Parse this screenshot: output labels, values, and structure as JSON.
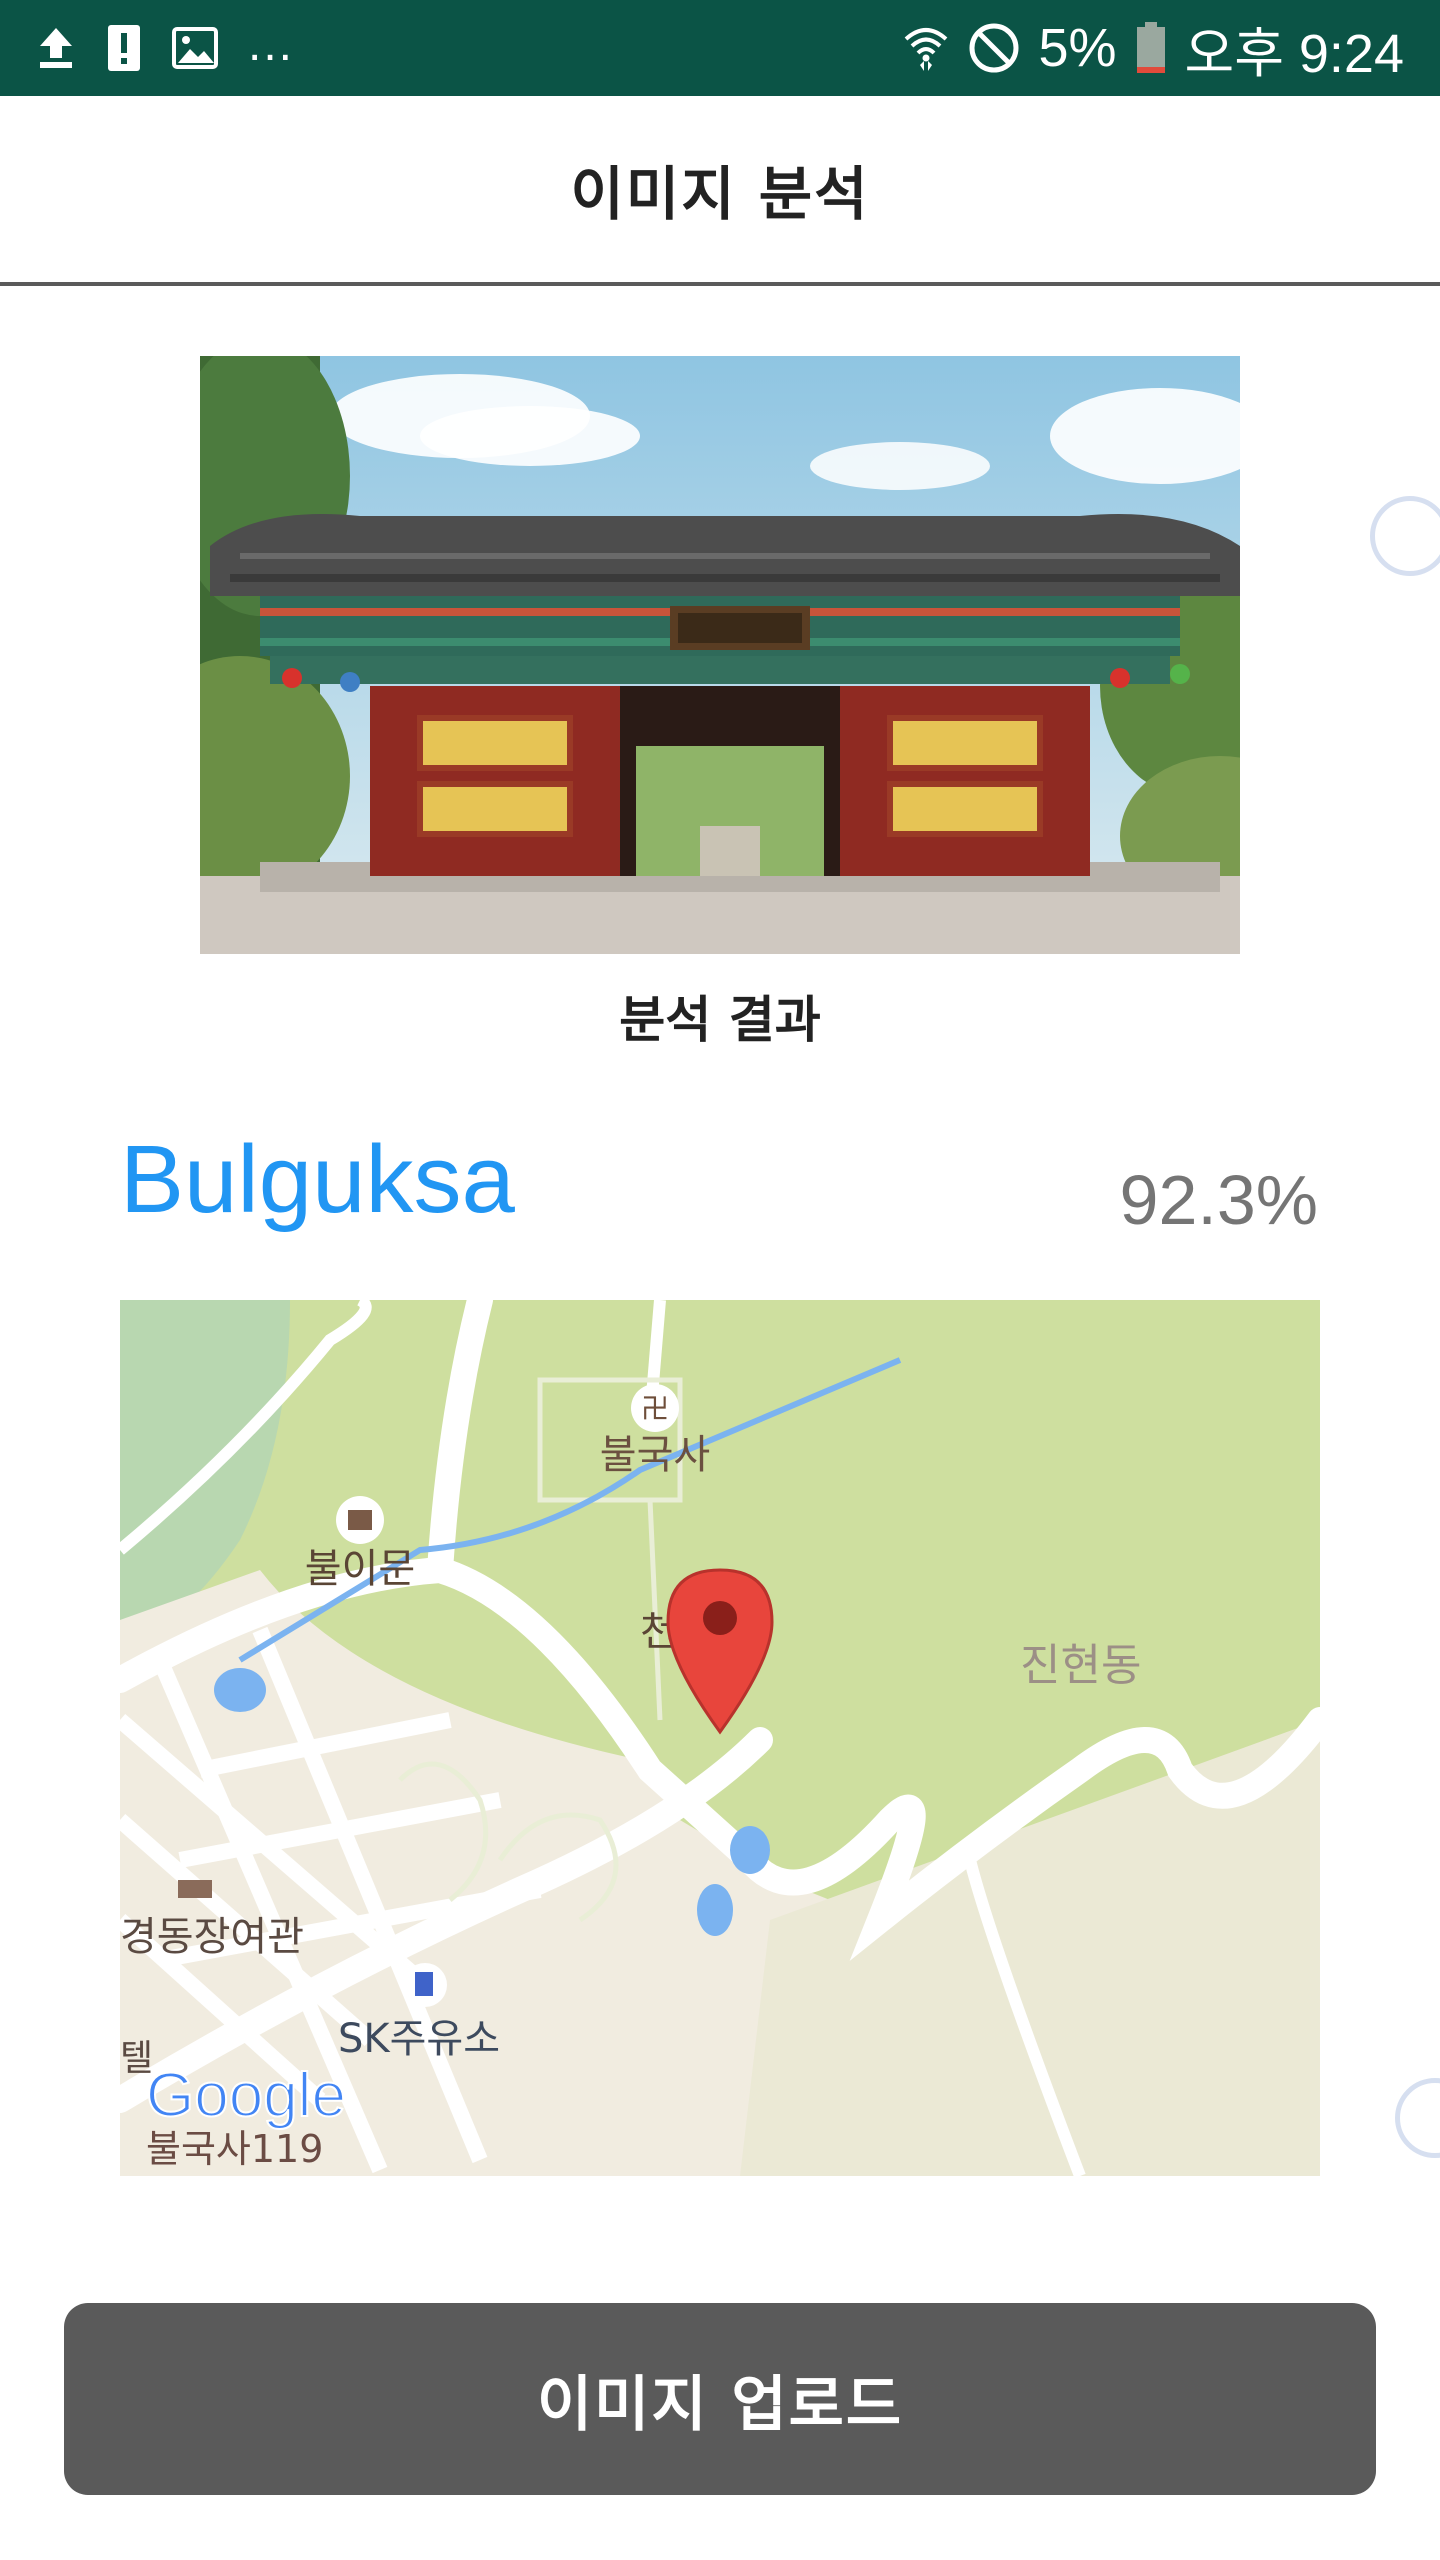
{
  "status_bar": {
    "battery_percent": "5%",
    "time": "오후 9:24",
    "icons": [
      "upload-icon",
      "alert-icon",
      "image-icon",
      "more-icon",
      "wifi-icon",
      "do-not-disturb-icon",
      "battery-icon"
    ],
    "overflow": "..."
  },
  "appbar": {
    "title": "이미지 분석"
  },
  "photo": {
    "description_icon": "temple-photo"
  },
  "result": {
    "section_title": "분석 결과",
    "landmark_name": "Bulguksa",
    "confidence": "92.3%"
  },
  "map": {
    "labels": {
      "temple": "불국사",
      "gate": "불이문",
      "village": "진현동",
      "inn": "경동장여관",
      "gas_station": "SK주유소",
      "fire_station": "불국사119",
      "partial_left": "텔",
      "partial_center": "천"
    },
    "logo": "Google",
    "colors": {
      "park": "#cedf9f",
      "land": "#f1ece0",
      "road": "#ffffff",
      "water": "#7bb3f0",
      "marker": "#e8453c"
    }
  },
  "upload_button": {
    "label": "이미지 업로드"
  }
}
